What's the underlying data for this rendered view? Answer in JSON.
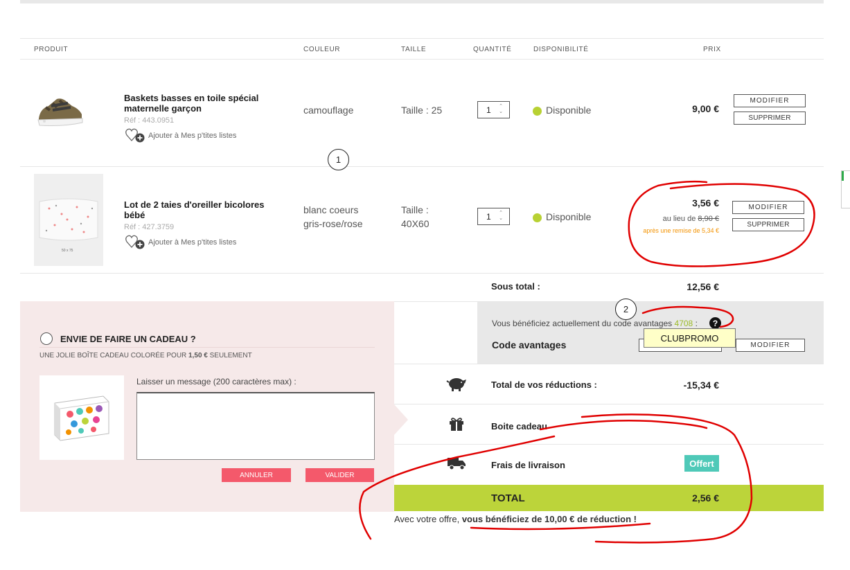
{
  "headers": {
    "produit": "PRODUIT",
    "couleur": "COULEUR",
    "taille": "TAILLE",
    "quantite": "QUANTITÉ",
    "disponibilite": "DISPONIBILITÉ",
    "prix": "PRIX"
  },
  "products": [
    {
      "name": "Baskets basses en toile spécial maternelle garçon",
      "ref": "Réf : 443.0951",
      "wishlist": "Ajouter à Mes p'tites listes",
      "color": "camouflage",
      "size": "Taille : 25",
      "qty": "1",
      "availability": "Disponible",
      "price": "9,00 €",
      "modify": "MODIFIER",
      "delete": "SUPPRIMER"
    },
    {
      "name": "Lot de 2 taies d'oreiller bicolores bébé",
      "ref": "Réf : 427.3759",
      "wishlist": "Ajouter à Mes p'tites listes",
      "color_line1": "blanc coeurs",
      "color_line2": "gris-rose/rose",
      "size_line1": "Taille :",
      "size_line2": "40X60",
      "qty": "1",
      "availability": "Disponible",
      "price": "3,56 €",
      "instead_of": "au lieu de",
      "old_price": "8,90 €",
      "discount_note": "après une remise de 5,34 €",
      "image_caption": "50 x 75",
      "modify": "MODIFIER",
      "delete": "SUPPRIMER"
    }
  ],
  "annotations": {
    "one": "1",
    "two": "2"
  },
  "subtotal": {
    "label": "Sous total :",
    "value": "12,56 €"
  },
  "code": {
    "text_before": "Vous bénéficiez actuellement du code avantages",
    "code_value": "4708",
    "colon": ":",
    "help": "?",
    "label": "Code avantages",
    "tooltip": "CLUBPROMO",
    "modify": "MODIFIER"
  },
  "gift": {
    "title": "ENVIE DE FAIRE UN CADEAU ?",
    "subtitle_before": "UNE JOLIE BOÎTE CADEAU COLORÉE POUR",
    "subtitle_price": "1,50 €",
    "subtitle_after": "SEULEMENT",
    "message_label": "Laisser un message (200 caractères max) :",
    "message_value": "",
    "cancel": "ANNULER",
    "validate": "VALIDER"
  },
  "summary": {
    "reductions_label": "Total de vos réductions :",
    "reductions_value": "-15,34 €",
    "giftbox_label": "Boite cadeau",
    "delivery_label": "Frais de livraison",
    "delivery_value": "Offert",
    "total_label": "TOTAL",
    "total_value": "2,56 €",
    "offer_before": "Avec votre offre,",
    "offer_bold": "vous bénéficiez de 10,00 € de réduction !"
  },
  "colors": {
    "accent_green": "#bcd43a",
    "availability_green": "#b8d133",
    "offert_teal": "#4fc9b8",
    "pink_button": "#f4596b",
    "gift_panel": "#f6e9e9",
    "discount_orange": "#f39200",
    "annotation_red": "#e00000"
  },
  "icons": [
    "heart-plus-icon",
    "piggy-bank-icon",
    "gift-icon",
    "truck-icon",
    "help-icon",
    "radio-icon"
  ]
}
